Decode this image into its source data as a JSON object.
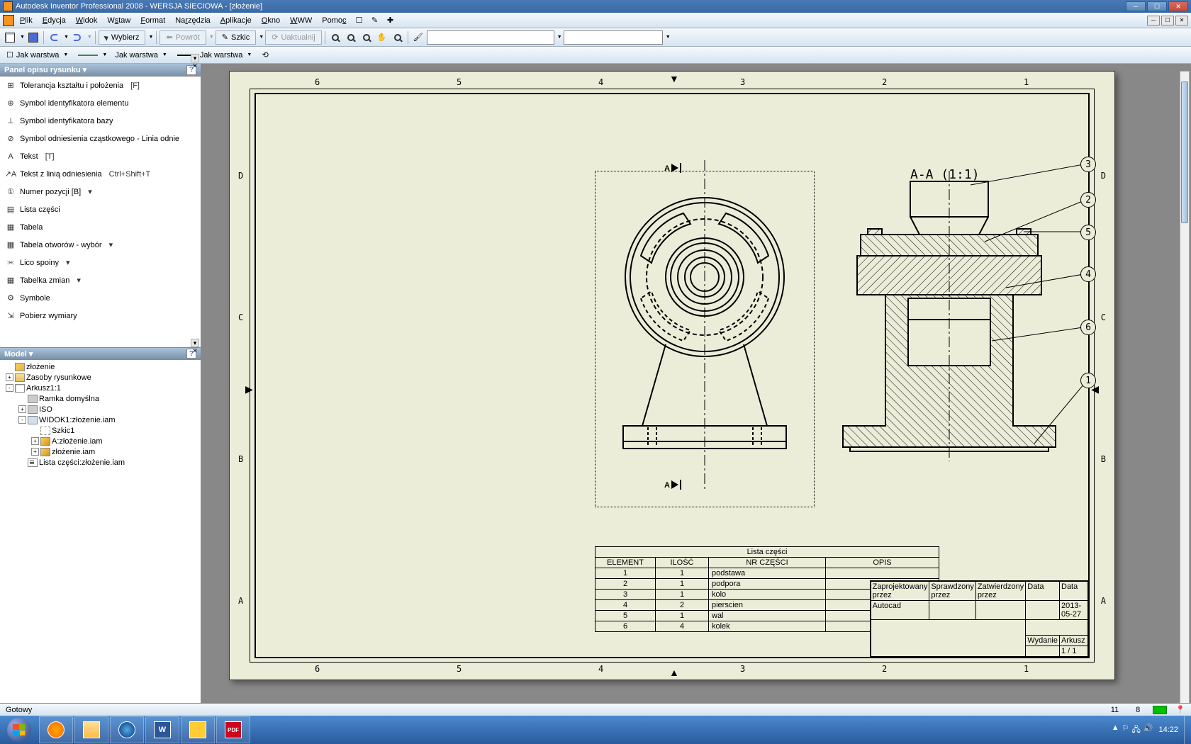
{
  "title_bar": {
    "app_title": "Autodesk Inventor Professional 2008 - WERSJA SIECIOWA - [złożenie]"
  },
  "menu": {
    "items": [
      "Plik",
      "Edycja",
      "Widok",
      "Wstaw",
      "Format",
      "Narzędzia",
      "Aplikacje",
      "Okno",
      "WWW",
      "Pomoc"
    ],
    "mnemonics": [
      "P",
      "E",
      "W",
      "s",
      "F",
      "r",
      "A",
      "O",
      "W",
      "c"
    ]
  },
  "toolbar1": {
    "wybierz": "Wybierz",
    "powrot": "Powrót",
    "szkic": "Szkic",
    "uaktualnij": "Uaktualnij"
  },
  "toolbar2": {
    "layer": "Jak warstwa"
  },
  "panel_drawing": {
    "title": "Panel opisu rysunku ▾",
    "items": [
      {
        "icon": "⊞",
        "label": "Tolerancja kształtu i położenia",
        "key": "[F]"
      },
      {
        "icon": "⊕",
        "label": "Symbol identyfikatora elementu",
        "key": ""
      },
      {
        "icon": "⊥",
        "label": "Symbol identyfikatora bazy",
        "key": ""
      },
      {
        "icon": "⊘",
        "label": "Symbol odniesienia cząstkowego - Linia odnie",
        "key": ""
      },
      {
        "icon": "A",
        "label": "Tekst",
        "key": "[T]"
      },
      {
        "icon": "↗A",
        "label": "Tekst z linią odniesienia",
        "key": "Ctrl+Shift+T"
      },
      {
        "icon": "①",
        "label": "Numer pozycji  [B]",
        "key": "▾"
      },
      {
        "icon": "▤",
        "label": "Lista części",
        "key": ""
      },
      {
        "icon": "▦",
        "label": "Tabela",
        "key": ""
      },
      {
        "icon": "▦",
        "label": "Tabela otworów - wybór",
        "key": "▾"
      },
      {
        "icon": "⫘",
        "label": "Lico spoiny",
        "key": "▾"
      },
      {
        "icon": "▦",
        "label": "Tabelka zmian",
        "key": "▾"
      },
      {
        "icon": "⚙",
        "label": "Symbole",
        "key": ""
      },
      {
        "icon": "⇲",
        "label": "Pobierz wymiary",
        "key": ""
      }
    ]
  },
  "panel_model": {
    "title": "Model ▾",
    "tree": [
      {
        "indent": 0,
        "toggle": "",
        "icon": "asm",
        "label": "złożenie"
      },
      {
        "indent": 0,
        "toggle": "+",
        "icon": "folder",
        "label": "Zasoby rysunkowe"
      },
      {
        "indent": 0,
        "toggle": "-",
        "icon": "sheet",
        "label": "Arkusz1:1"
      },
      {
        "indent": 1,
        "toggle": "",
        "icon": "frame",
        "label": "Ramka domyślna"
      },
      {
        "indent": 1,
        "toggle": "+",
        "icon": "frame",
        "label": "ISO"
      },
      {
        "indent": 1,
        "toggle": "-",
        "icon": "view",
        "label": "WIDOK1:złożenie.iam"
      },
      {
        "indent": 2,
        "toggle": "",
        "icon": "sketch",
        "label": "Szkic1"
      },
      {
        "indent": 2,
        "toggle": "+",
        "icon": "part",
        "label": "A:złożenie.iam"
      },
      {
        "indent": 2,
        "toggle": "+",
        "icon": "part",
        "label": "złożenie.iam"
      },
      {
        "indent": 1,
        "toggle": "",
        "icon": "list",
        "label": "Lista części:złożenie.iam"
      }
    ]
  },
  "drawing": {
    "ruler_top": [
      "6",
      "5",
      "4",
      "3",
      "2",
      "1"
    ],
    "ruler_side": [
      "D",
      "C",
      "B",
      "A"
    ],
    "a_label": "A",
    "section": "A-A (1:1)",
    "balloons": [
      "3",
      "2",
      "5",
      "4",
      "6",
      "1"
    ],
    "parts_title": "Lista części",
    "parts_headers": [
      "ELEMENT",
      "ILOŚĆ",
      "NR CZĘŚCI",
      "OPIS"
    ],
    "parts_rows": [
      [
        "1",
        "1",
        "podstawa",
        ""
      ],
      [
        "2",
        "1",
        "podpora",
        ""
      ],
      [
        "3",
        "1",
        "kolo",
        ""
      ],
      [
        "4",
        "2",
        "pierscien",
        ""
      ],
      [
        "5",
        "1",
        "wal",
        ""
      ],
      [
        "6",
        "4",
        "kolek",
        ""
      ]
    ],
    "titleblock": {
      "zaprojektowal": "Zaprojektowany przez",
      "autocad": "Autocad",
      "sprawdzil": "Sprawdzony przez",
      "zatwierdzil": "Zatwierdzony przez",
      "data": "Data",
      "data_val": "2013-05-27",
      "wydanie": "Wydanie",
      "arkusz": "Arkusz",
      "arkusz_val": "1 / 1"
    }
  },
  "status": {
    "ready": "Gotowy",
    "pos1": "11",
    "pos2": "8"
  },
  "tray": {
    "time": "14:22"
  }
}
